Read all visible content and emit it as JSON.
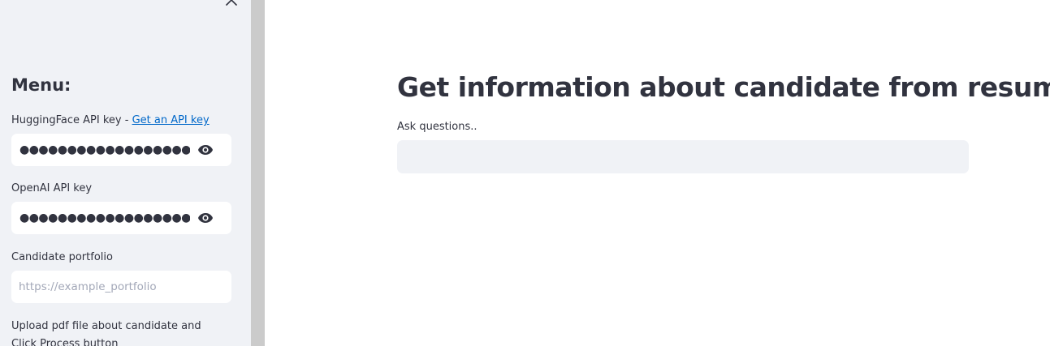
{
  "sidebar": {
    "close_icon": "close-icon",
    "menu_title": "Menu:",
    "huggingface": {
      "label_prefix": "HuggingFace API key - ",
      "link_text": "Get an API key",
      "masked_value": "●●●●●●●●●●●●●●●●●●●●●",
      "toggle_icon": "eye-icon"
    },
    "openai": {
      "label": "OpenAI API key",
      "masked_value": "●●●●●●●●●●●●●●●●●●●●●",
      "toggle_icon": "eye-icon"
    },
    "portfolio": {
      "label": "Candidate portfolio",
      "value": "",
      "placeholder": "https://example_portfolio"
    },
    "upload_label": "Upload pdf file about candidate and Click Process button"
  },
  "main": {
    "title": "Get information about candidate from resume",
    "question": {
      "label": "Ask questions..",
      "value": ""
    }
  },
  "colors": {
    "sidebar_bg": "#f0f2f6",
    "text": "#31333f",
    "link": "#0068c9",
    "placeholder": "#a3a8b8",
    "scrollbar": "#cbcbcb"
  }
}
